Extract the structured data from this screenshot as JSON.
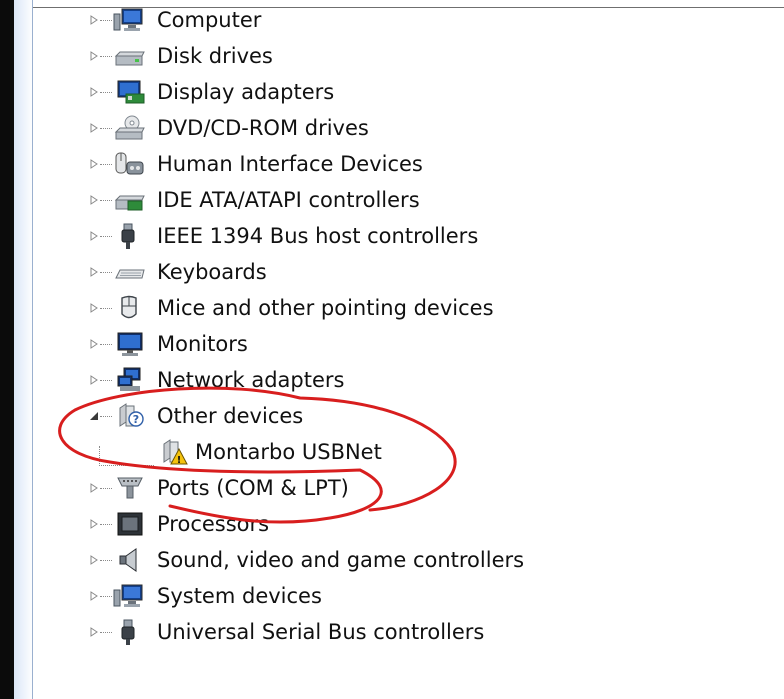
{
  "tree": {
    "items": [
      {
        "label": "Computer",
        "icon": "computer-icon",
        "expanded": false
      },
      {
        "label": "Disk drives",
        "icon": "disk-drive-icon",
        "expanded": false
      },
      {
        "label": "Display adapters",
        "icon": "display-adapter-icon",
        "expanded": false
      },
      {
        "label": "DVD/CD-ROM drives",
        "icon": "dvd-drive-icon",
        "expanded": false
      },
      {
        "label": "Human Interface Devices",
        "icon": "hid-icon",
        "expanded": false
      },
      {
        "label": "IDE ATA/ATAPI controllers",
        "icon": "ide-controller-icon",
        "expanded": false
      },
      {
        "label": "IEEE 1394 Bus host controllers",
        "icon": "firewire-icon",
        "expanded": false
      },
      {
        "label": "Keyboards",
        "icon": "keyboard-icon",
        "expanded": false
      },
      {
        "label": "Mice and other pointing devices",
        "icon": "mouse-icon",
        "expanded": false
      },
      {
        "label": "Monitors",
        "icon": "monitor-icon",
        "expanded": false
      },
      {
        "label": "Network adapters",
        "icon": "network-adapter-icon",
        "expanded": false
      },
      {
        "label": "Other devices",
        "icon": "unknown-device-icon",
        "expanded": true,
        "children": [
          {
            "label": "Montarbo USBNet",
            "icon": "warning-device-icon"
          }
        ]
      },
      {
        "label": "Ports (COM & LPT)",
        "icon": "port-icon",
        "expanded": false
      },
      {
        "label": "Processors",
        "icon": "processor-icon",
        "expanded": false
      },
      {
        "label": "Sound, video and game controllers",
        "icon": "speaker-icon",
        "expanded": false
      },
      {
        "label": "System devices",
        "icon": "system-device-icon",
        "expanded": false
      },
      {
        "label": "Universal Serial Bus controllers",
        "icon": "usb-icon",
        "expanded": false
      }
    ]
  },
  "annotation": {
    "color": "#d81e1e",
    "shape": "hand-drawn-circle"
  }
}
